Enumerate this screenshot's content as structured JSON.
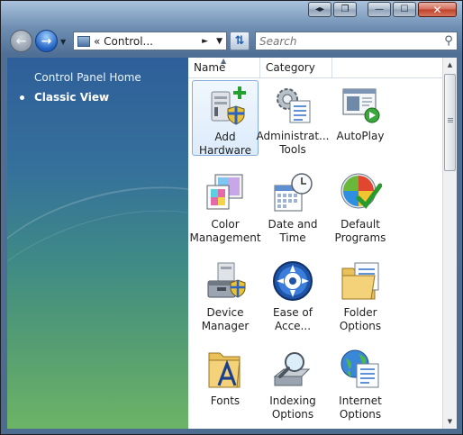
{
  "toolbar": {
    "address_chevron": "«",
    "address_text": "Control...",
    "address_arrow": "►",
    "address_dropdown": "▼",
    "search_placeholder": "Search"
  },
  "sidebar": {
    "home_link": "Control Panel Home",
    "classic_view": "Classic View"
  },
  "columns": {
    "name": "Name",
    "category": "Category"
  },
  "items": [
    {
      "label": "Add Hardware",
      "icon": "add-hardware-icon",
      "selected": true
    },
    {
      "label": "Administrat... Tools",
      "icon": "administrative-tools-icon"
    },
    {
      "label": "AutoPlay",
      "icon": "autoplay-icon"
    },
    {
      "label": "Color Management",
      "icon": "color-management-icon"
    },
    {
      "label": "Date and Time",
      "icon": "date-time-icon"
    },
    {
      "label": "Default Programs",
      "icon": "default-programs-icon"
    },
    {
      "label": "Device Manager",
      "icon": "device-manager-icon"
    },
    {
      "label": "Ease of Acce...",
      "icon": "ease-of-access-icon"
    },
    {
      "label": "Folder Options",
      "icon": "folder-options-icon"
    },
    {
      "label": "Fonts",
      "icon": "fonts-icon"
    },
    {
      "label": "Indexing Options",
      "icon": "indexing-options-icon"
    },
    {
      "label": "Internet Options",
      "icon": "internet-options-icon"
    }
  ],
  "colors": {
    "selection_border": "#84acdd",
    "sidebar_top": "#2f5f9a",
    "sidebar_bottom": "#6cb466"
  }
}
